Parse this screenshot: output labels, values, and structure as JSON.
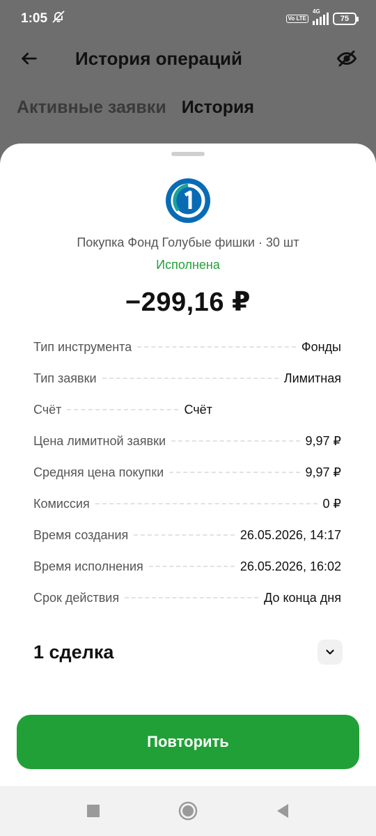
{
  "status_bar": {
    "time": "1:05",
    "volte": "Vo LTE",
    "network": "4G",
    "battery": "75"
  },
  "app_bar": {
    "title": "История операций",
    "back_icon": "arrow-left-icon",
    "visibility_icon": "eye-off-icon"
  },
  "tabs": [
    {
      "label": "Активные заявки",
      "active": false
    },
    {
      "label": "История",
      "active": true
    }
  ],
  "sheet": {
    "subtitle": "Покупка Фонд Голубые фишки · 30 шт",
    "status": "Исполнена",
    "amount": "−299,16 ₽",
    "details": [
      {
        "key": "Тип инструмента",
        "value": "Фонды"
      },
      {
        "key": "Тип заявки",
        "value": "Лимитная"
      },
      {
        "key": "Счёт",
        "value": "Счёт"
      },
      {
        "key": "Цена лимитной заявки",
        "value": "9,97 ₽"
      },
      {
        "key": "Средняя цена покупки",
        "value": "9,97 ₽"
      },
      {
        "key": "Комиссия",
        "value": "0 ₽"
      },
      {
        "key": "Время создания",
        "value": "26.05.2026, 14:17"
      },
      {
        "key": "Время исполнения",
        "value": "26.05.2026, 16:02"
      },
      {
        "key": "Срок действия",
        "value": "До конца дня"
      }
    ],
    "deals_label": "1 сделка",
    "repeat_label": "Повторить"
  },
  "colors": {
    "accent_green": "#21a038",
    "scrim": "#6e6e6e",
    "logo_blue": "#0a6bb5",
    "logo_teal": "#1aa39a"
  }
}
